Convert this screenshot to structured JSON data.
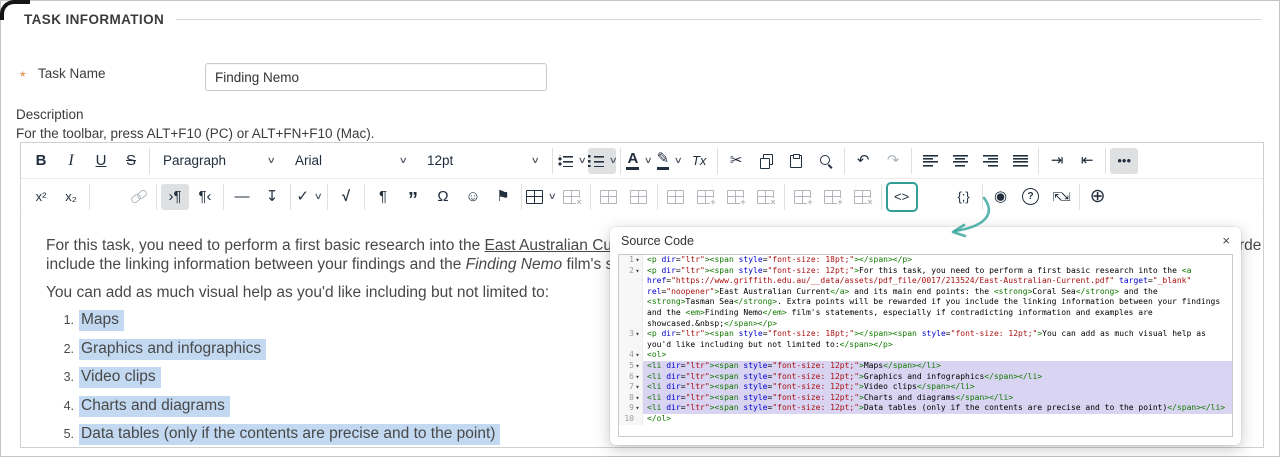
{
  "page": {
    "section_title": "TASK INFORMATION"
  },
  "task_name": {
    "required_marker": "*",
    "label": "Task Name",
    "value": "Finding Nemo"
  },
  "description": {
    "label": "Description",
    "toolbar_hint": "For the toolbar, press ALT+F10 (PC) or ALT+FN+F10 (Mac)."
  },
  "colors": {
    "accent_teal": "#2f9e97",
    "editor_selection": "#c3d9f1",
    "code_selection": "#d8d4f2",
    "required_orange": "#d9822b",
    "icon": "#222f3e",
    "disabled_icon": "#b1b7bd"
  },
  "toolbar": {
    "rows": [
      [
        [
          {
            "name": "bold-button",
            "glyph": "B",
            "cls": "g-bold"
          },
          {
            "name": "italic-button",
            "glyph": "I",
            "cls": "g-italic"
          },
          {
            "name": "underline-button",
            "glyph": "U",
            "cls": "g-underline"
          },
          {
            "name": "strikethrough-button",
            "glyph": "S",
            "cls": "g-strike"
          }
        ],
        [
          {
            "name": "paragraph-format-select",
            "label": "Paragraph",
            "chevron": true,
            "wide": 112
          },
          {
            "name": "font-family-select",
            "label": "Arial",
            "chevron": true,
            "wide": 112
          },
          {
            "name": "font-size-select",
            "label": "12pt",
            "chevron": true,
            "wide": 112
          }
        ],
        [
          {
            "name": "bullet-list-button",
            "shape": "ul",
            "chevron": true
          },
          {
            "name": "numbered-list-button",
            "shape": "ol",
            "chevron": true,
            "active": true
          }
        ],
        [
          {
            "name": "text-color-button",
            "glyph": "A",
            "cls": "g-colorA",
            "chevron": true
          },
          {
            "name": "highlight-color-button",
            "glyph": "✎",
            "cls": "g-pen",
            "chevron": true
          },
          {
            "name": "clear-formatting-button",
            "glyph": "Tx",
            "cls": "g-clear"
          }
        ],
        [
          {
            "name": "cut-button",
            "glyph": "✂"
          },
          {
            "name": "copy-button",
            "css": true
          },
          {
            "name": "paste-button",
            "css": true
          },
          {
            "name": "search-button",
            "css": true
          }
        ],
        [
          {
            "name": "undo-button",
            "glyph": "↶"
          },
          {
            "name": "redo-button",
            "glyph": "↷",
            "disabled": true
          }
        ],
        [
          {
            "name": "align-left-button",
            "shape": "al"
          },
          {
            "name": "align-center-button",
            "shape": "ac"
          },
          {
            "name": "align-right-button",
            "shape": "ar"
          },
          {
            "name": "align-justify-button",
            "shape": "aj"
          }
        ],
        [
          {
            "name": "indent-button",
            "glyph": "⇥"
          },
          {
            "name": "outdent-button",
            "glyph": "⇤"
          }
        ],
        [
          {
            "name": "more-tools-button",
            "glyph": "•••",
            "cls": "g-small",
            "active": true
          }
        ]
      ],
      [
        [
          {
            "name": "superscript-button",
            "glyph": "x²",
            "cls": "g-small"
          },
          {
            "name": "subscript-button",
            "glyph": "x₂",
            "cls": "g-small"
          }
        ],
        [
          {
            "name": "insert-link-button",
            "css": true
          },
          {
            "name": "unlink-button",
            "css": true,
            "disabled": true
          }
        ],
        [
          {
            "name": "ltr-paragraph-button",
            "glyph": "›¶",
            "active": true
          },
          {
            "name": "rtl-paragraph-button",
            "glyph": "¶‹"
          }
        ],
        [
          {
            "name": "horizontal-rule-button",
            "glyph": "—"
          },
          {
            "name": "page-break-button",
            "glyph": "↧"
          }
        ],
        [
          {
            "name": "spellcheck-button",
            "glyph": "✓",
            "chevron": true
          }
        ],
        [
          {
            "name": "math-equation-button",
            "glyph": "√",
            "cls": "g-bold"
          }
        ],
        [
          {
            "name": "show-invisibles-button",
            "glyph": "¶"
          },
          {
            "name": "blockquote-button",
            "glyph": "”",
            "cls": "g-quote"
          },
          {
            "name": "special-character-button",
            "glyph": "Ω"
          },
          {
            "name": "emoticons-button",
            "glyph": "☺"
          },
          {
            "name": "anchor-button",
            "glyph": "⚑"
          }
        ],
        [
          {
            "name": "table-button",
            "shape": "table",
            "chevron": true
          },
          {
            "name": "delete-table-button",
            "shape": "table",
            "overlay": "×",
            "disabled": true
          }
        ],
        [
          {
            "name": "cell-properties-button",
            "shape": "table",
            "disabled": true
          },
          {
            "name": "merge-cells-button",
            "shape": "table",
            "disabled": true
          }
        ],
        [
          {
            "name": "split-cells-button",
            "shape": "table",
            "disabled": true
          },
          {
            "name": "insert-row-before-button",
            "shape": "table",
            "overlay": "+",
            "disabled": true
          },
          {
            "name": "insert-row-after-button",
            "shape": "table",
            "overlay": "+",
            "disabled": true
          },
          {
            "name": "delete-row-button",
            "shape": "table",
            "overlay": "×",
            "disabled": true
          }
        ],
        [
          {
            "name": "insert-col-before-button",
            "shape": "table",
            "overlay": "+",
            "disabled": true
          },
          {
            "name": "insert-col-after-button",
            "shape": "table",
            "overlay": "+",
            "disabled": true
          },
          {
            "name": "delete-col-button",
            "shape": "table",
            "overlay": "×",
            "disabled": true
          }
        ],
        [
          {
            "name": "source-code-button",
            "glyph": "<>",
            "cls": "g-small",
            "accent": true
          },
          {
            "name": "accessibility-checker-button",
            "css": true
          },
          {
            "name": "code-sample-button",
            "glyph": "{;}",
            "cls": "g-small"
          }
        ],
        [
          {
            "name": "preview-button",
            "glyph": "◉"
          },
          {
            "name": "help-button",
            "glyph": "?",
            "cls": "g-circle"
          },
          {
            "name": "fullscreen-button",
            "glyph": "⇱⇲",
            "cls": "g-tight"
          }
        ],
        [
          {
            "name": "insert-button",
            "glyph": "⊕",
            "cls": "g-big"
          }
        ]
      ]
    ]
  },
  "editor": {
    "paragraph1_lines": [
      [
        {
          "text": "For this task, you need to perform a first basic research into the ",
          "style": "plain"
        },
        {
          "text": "East Australian Current",
          "style": "link"
        },
        {
          "text": " and its main end points: the ",
          "style": "plain"
        },
        {
          "text": "Coral Sea",
          "style": "bold"
        },
        {
          "text": " and the ",
          "style": "plain"
        },
        {
          "text": "Tasman Sea",
          "style": "bold"
        },
        {
          "text": ". Extra points will be rewarded if you",
          "style": "plain"
        }
      ],
      [
        {
          "text": "include the linking information between your findings and the ",
          "style": "plain"
        },
        {
          "text": "Finding Nemo",
          "style": "italic"
        },
        {
          "text": " film's statements, especially if contradicting information and examples are showcased.",
          "style": "plain"
        }
      ]
    ],
    "paragraph2": "You can add as much visual help as you'd like including but not limited to:",
    "list_items": [
      "Maps",
      "Graphics and infographics",
      "Video clips",
      "Charts and diagrams",
      "Data tables (only if the contents are precise and to the point)"
    ]
  },
  "source_dialog": {
    "title": "Source Code",
    "close_glyph": "×",
    "lines": [
      {
        "n": 1,
        "fold": true,
        "selected": false,
        "text": "<p dir=\"ltr\"><span style=\"font-size: 18pt;\"></span></p>"
      },
      {
        "n": 2,
        "fold": true,
        "selected": false,
        "text": "<p dir=\"ltr\"><span style=\"font-size: 12pt;\">For this task, you need to perform a first basic research into the <a href=\"https://www.griffith.edu.au/__data/assets/pdf_file/0017/213524/East-Australian-Current.pdf\" target=\"_blank\" rel=\"noopener\">East Australian Current</a> and its main end points: the <strong>Coral Sea</strong> and the <strong>Tasman Sea</strong>. Extra points will be rewarded if you include the linking information between your findings and the <em>Finding Nemo</em> film's statements, especially if contradicting information and examples are showcased.&nbsp;</span></p>"
      },
      {
        "n": 3,
        "fold": true,
        "selected": false,
        "text": "<p dir=\"ltr\"><span style=\"font-size: 18pt;\"></span><span style=\"font-size: 12pt;\">You can add as much visual help as you'd like including but not limited to:</span></p>"
      },
      {
        "n": 4,
        "fold": true,
        "selected": false,
        "text": "<ol>"
      },
      {
        "n": 5,
        "fold": true,
        "selected": true,
        "text": "<li dir=\"ltr\"><span style=\"font-size: 12pt;\">Maps</span></li>"
      },
      {
        "n": 6,
        "fold": true,
        "selected": true,
        "text": "<li dir=\"ltr\"><span style=\"font-size: 12pt;\">Graphics and infographics</span></li>"
      },
      {
        "n": 7,
        "fold": true,
        "selected": true,
        "text": "<li dir=\"ltr\"><span style=\"font-size: 12pt;\">Video clips</span></li>"
      },
      {
        "n": 8,
        "fold": true,
        "selected": true,
        "text": "<li dir=\"ltr\"><span style=\"font-size: 12pt;\">Charts and diagrams</span></li>"
      },
      {
        "n": 9,
        "fold": true,
        "selected": true,
        "text": "<li dir=\"ltr\"><span style=\"font-size: 12pt;\">Data tables (only if the contents are precise and to the point)</span></li>"
      },
      {
        "n": 10,
        "fold": false,
        "selected": false,
        "text": "</ol>"
      }
    ]
  }
}
